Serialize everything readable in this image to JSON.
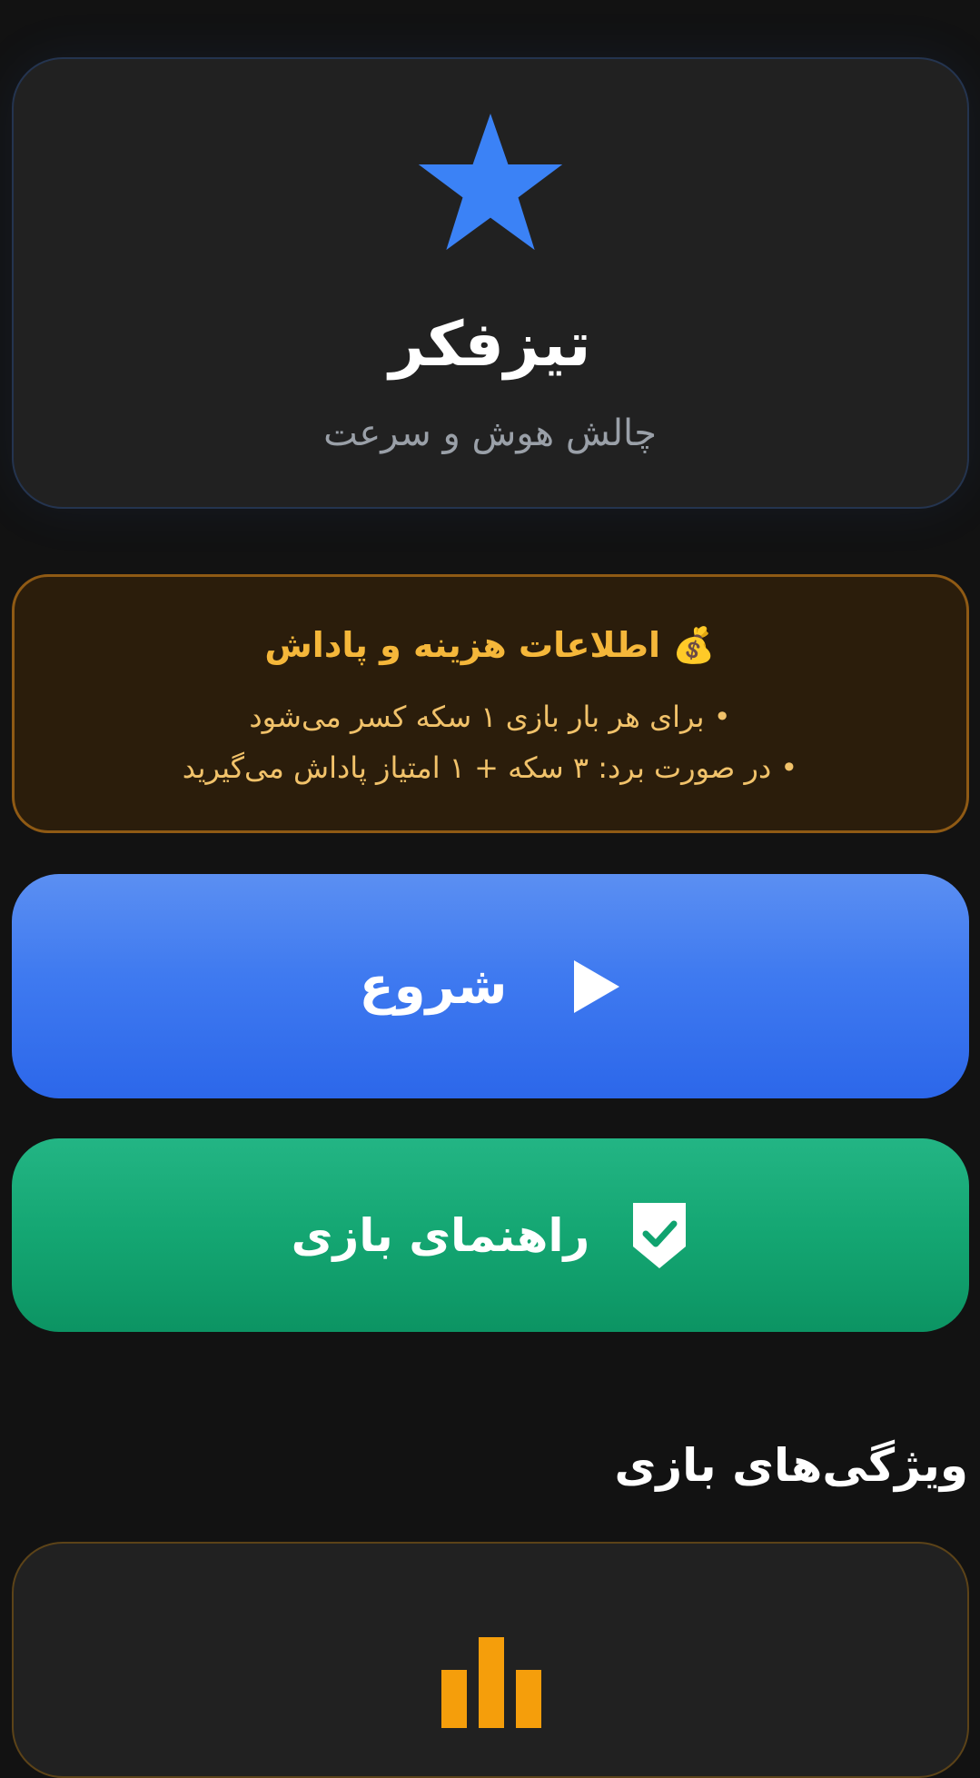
{
  "header": {
    "icon": "star-icon",
    "title": "تیزفکر",
    "subtitle": "چالش هوش و سرعت",
    "accent_color": "#3b82f6"
  },
  "info": {
    "icon": "money-bag-icon",
    "title": "💰 اطلاعات هزینه و پاداش",
    "lines": [
      "• برای هر بار بازی ۱ سکه کسر می‌شود",
      "• در صورت برد: ۳ سکه + ۱ امتیاز پاداش می‌گیرید"
    ],
    "text_color": "#f5b73a"
  },
  "buttons": {
    "start": {
      "label": "شروع",
      "icon": "play-icon",
      "color": "#3b74ef"
    },
    "guide": {
      "label": "راهنمای بازی",
      "icon": "shield-check-icon",
      "color": "#10a36f"
    }
  },
  "features": {
    "title": "ویژگی‌های بازی",
    "first_card_icon": "chart-bars-icon",
    "first_card_color": "#f59e0b"
  }
}
